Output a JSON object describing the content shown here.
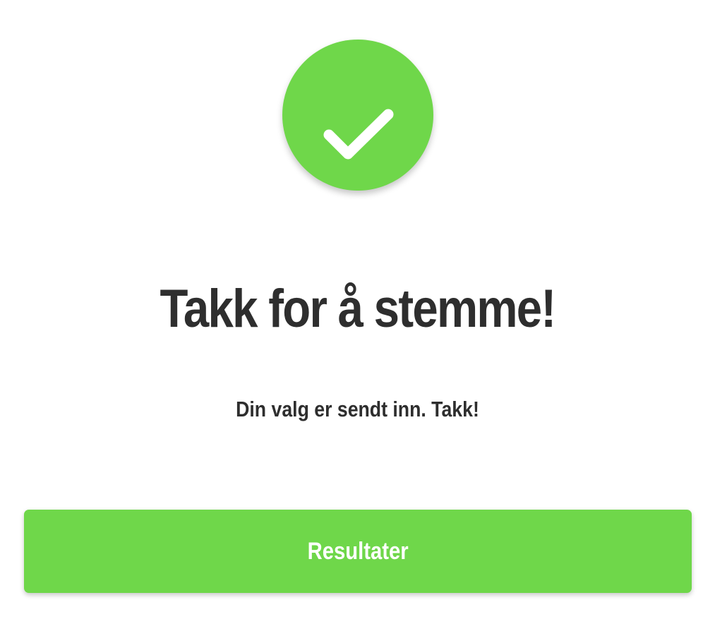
{
  "colors": {
    "accent": "#6fd74a",
    "text": "#2e2e2e",
    "background": "#ffffff",
    "button_text": "#ffffff"
  },
  "status_icon": "checkmark-icon",
  "heading": "Takk for å stemme!",
  "message": "Din valg er sendt inn. Takk!",
  "results_button": {
    "label": "Resultater"
  }
}
